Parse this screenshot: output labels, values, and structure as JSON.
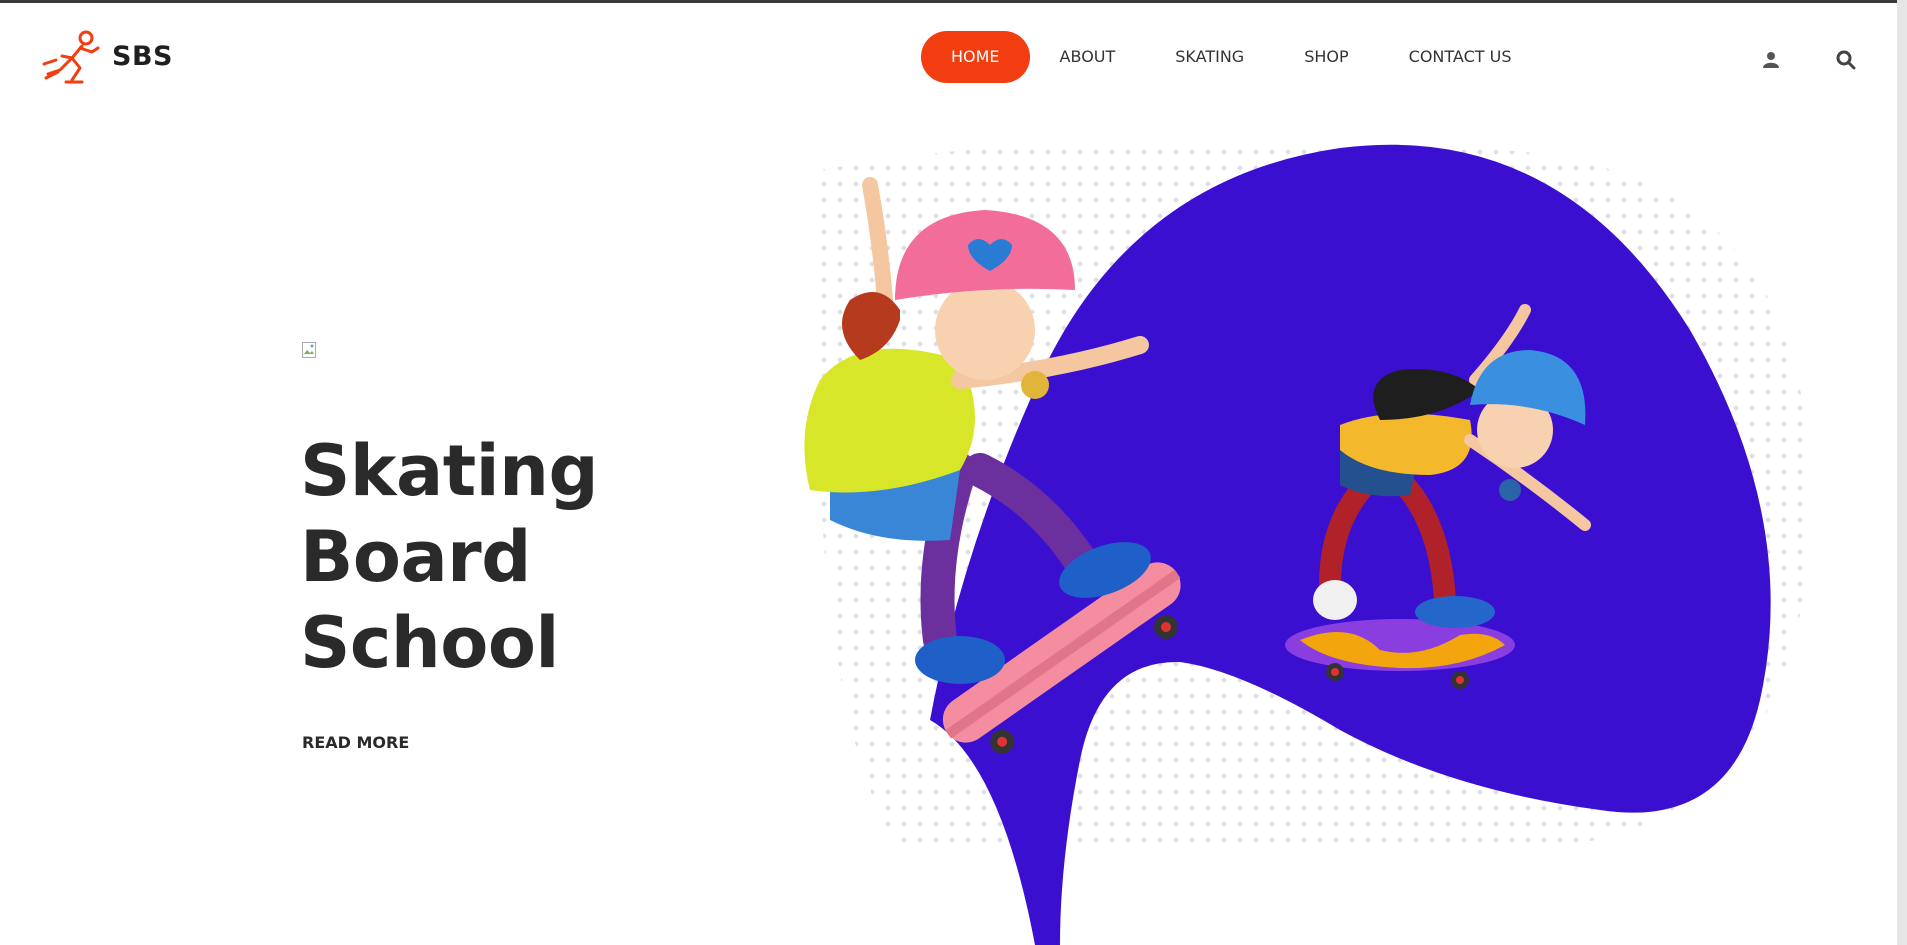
{
  "header": {
    "logo_text": "SBS",
    "nav": [
      {
        "label": "HOME",
        "active": true
      },
      {
        "label": "ABOUT",
        "active": false
      },
      {
        "label": "SKATING",
        "active": false
      },
      {
        "label": "SHOP",
        "active": false
      },
      {
        "label": "CONTACT US",
        "active": false
      }
    ],
    "icons": [
      "user-icon",
      "search-icon"
    ]
  },
  "hero": {
    "title_lines": [
      "Skating",
      "Board",
      "School"
    ],
    "read_more": "READ MORE"
  },
  "colors": {
    "accent": "#f23d10",
    "blob": "#3b0fd0",
    "text": "#2a2a2a"
  }
}
